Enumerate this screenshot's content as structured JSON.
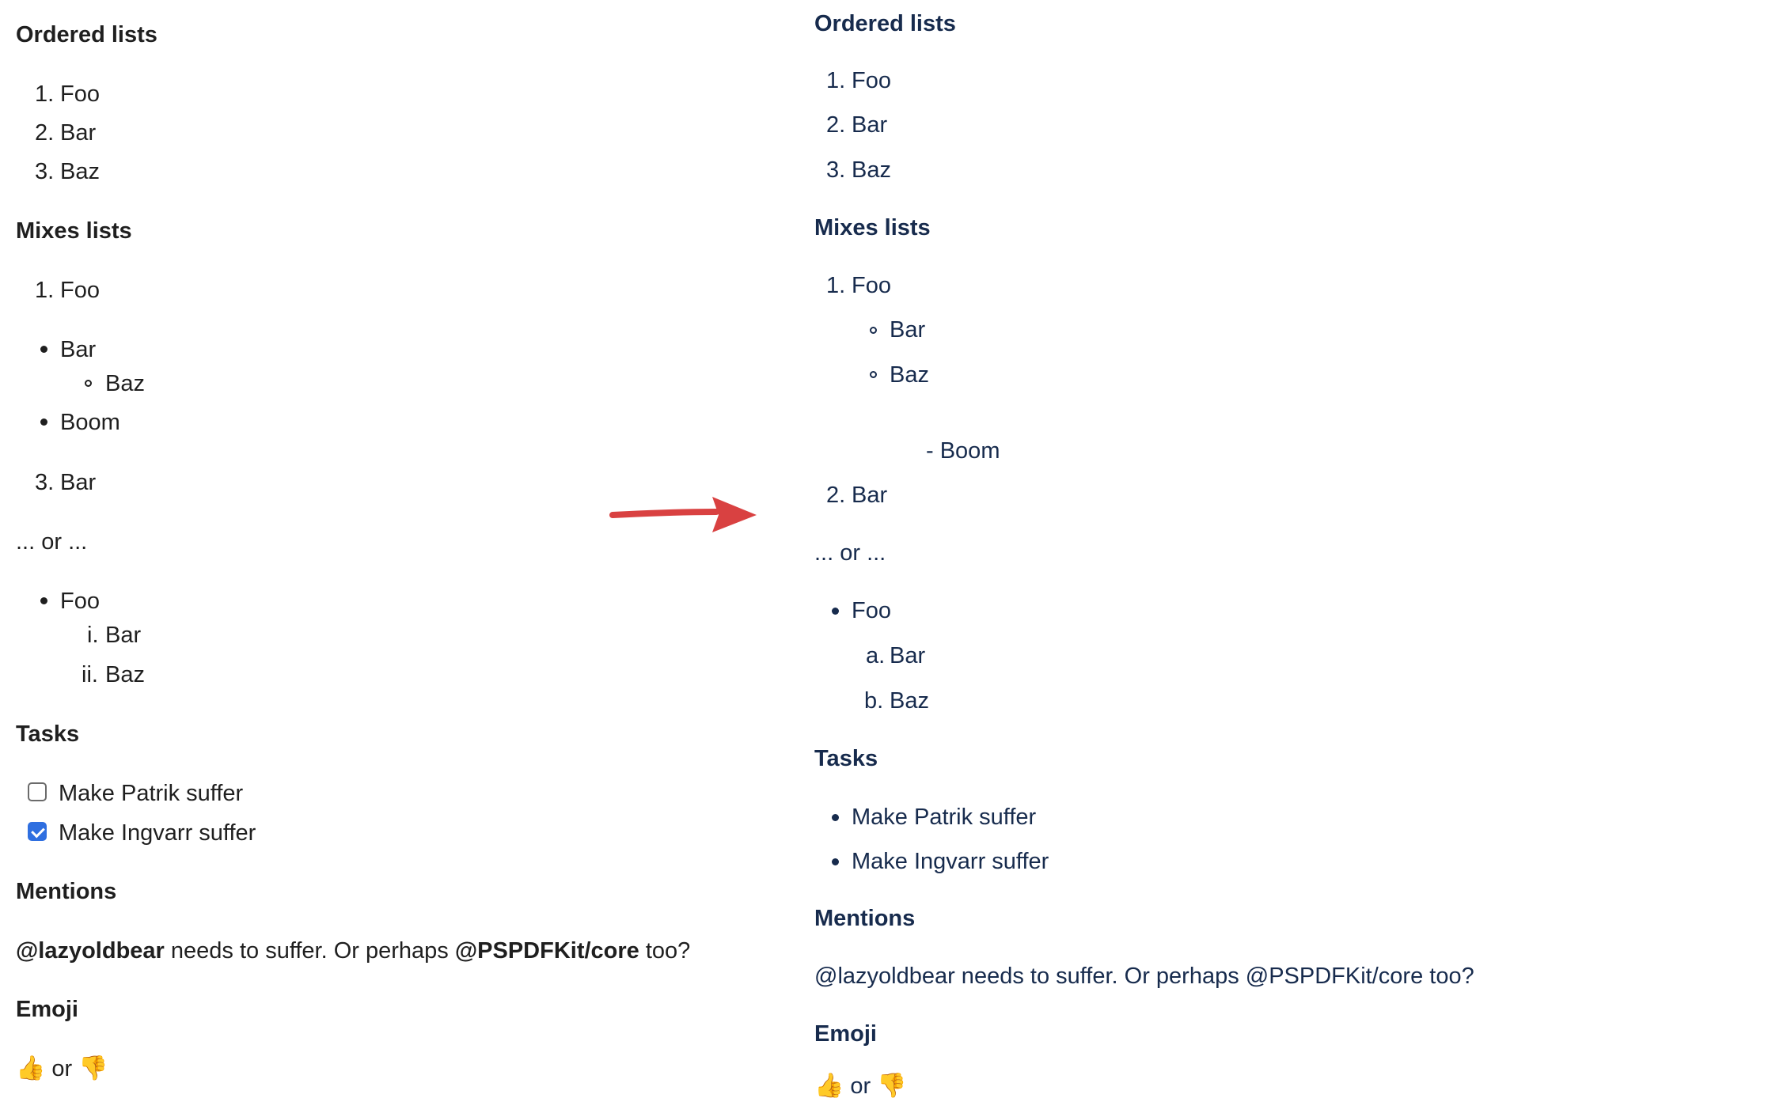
{
  "left": {
    "sections": {
      "ordered_lists": {
        "title": "Ordered lists",
        "items": [
          "Foo",
          "Bar",
          "Baz"
        ],
        "markers": [
          "1.",
          "2.",
          "3."
        ]
      },
      "mixes_lists": {
        "title": "Mixes lists",
        "ordered_1_marker": "1.",
        "ordered_1_text": "Foo",
        "bullet_1": "Bar",
        "sub_bullet_1": "Baz",
        "bullet_2": "Boom",
        "ordered_3_marker": "3.",
        "ordered_3_text": "Bar"
      },
      "or_text": "... or ...",
      "roman_list": {
        "bullet": "Foo",
        "i_marker": "i.",
        "i_text": "Bar",
        "ii_marker": "ii.",
        "ii_text": "Baz"
      },
      "tasks": {
        "title": "Tasks",
        "task_1": "Make Patrik suffer",
        "task_2": "Make Ingvarr suffer",
        "task_1_checked": false,
        "task_2_checked": true
      },
      "mentions": {
        "title": "Mentions",
        "mention_1": "@lazyoldbear",
        "mid_text": " needs to suffer. Or perhaps ",
        "mention_2": "@PSPDFKit/core",
        "tail_text": " too?"
      },
      "emoji": {
        "title": "Emoji",
        "thumbs_up": "👍",
        "or": " or ",
        "thumbs_down": "👎"
      }
    }
  },
  "right": {
    "sections": {
      "ordered_lists": {
        "title": "Ordered lists",
        "items": [
          "Foo",
          "Bar",
          "Baz"
        ],
        "markers": [
          "1.",
          "2.",
          "3."
        ]
      },
      "mixes_lists": {
        "title": "Mixes lists",
        "ordered_1_marker": "1.",
        "ordered_1_text": "Foo",
        "sub_bullet_1": "Bar",
        "sub_bullet_2": "Baz",
        "dash_text": "- Boom",
        "ordered_2_marker": "2.",
        "ordered_2_text": "Bar"
      },
      "or_text": "... or ...",
      "alpha_list": {
        "bullet": "Foo",
        "a_marker": "a.",
        "a_text": "Bar",
        "b_marker": "b.",
        "b_text": "Baz"
      },
      "tasks": {
        "title": "Tasks",
        "task_1": "Make Patrik suffer",
        "task_2": "Make Ingvarr suffer"
      },
      "mentions": {
        "title": "Mentions",
        "text": "@lazyoldbear needs to suffer. Or perhaps @PSPDFKit/core too?"
      },
      "emoji": {
        "title": "Emoji",
        "thumbs_up": "👍",
        "or": " or ",
        "thumbs_down": "👎"
      }
    }
  },
  "arrow": {
    "color": "#d94141"
  },
  "colors": {
    "text_left": "#1f1f1f",
    "text_right": "#172b4d",
    "checkbox_checked": "#2f6fe0"
  }
}
